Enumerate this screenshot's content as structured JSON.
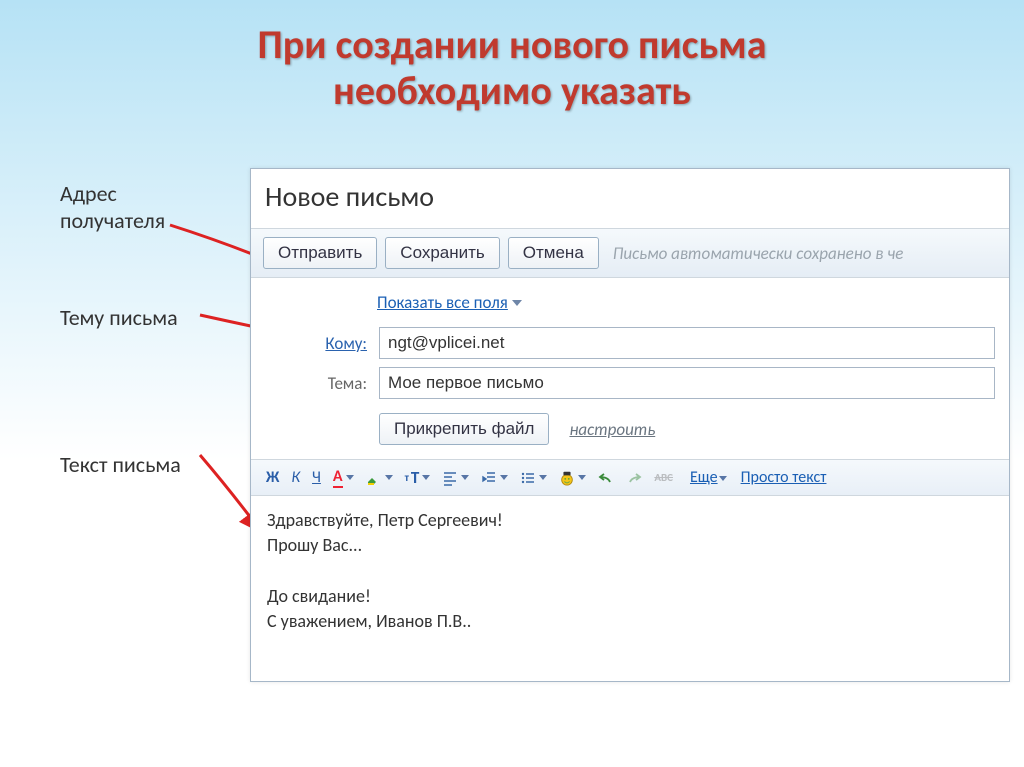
{
  "slide": {
    "title": "При создании нового письма\nнеобходимо указать"
  },
  "labels": {
    "address": "Адрес\nполучателя",
    "subject": "Тему письма",
    "body": "Текст письма"
  },
  "window": {
    "title": "Новое письмо",
    "buttons": {
      "send": "Отправить",
      "save": "Сохранить",
      "cancel": "Отмена"
    },
    "status": "Письмо автоматически сохранено в че",
    "show_all_fields": "Показать все поля",
    "to_label": "Кому:",
    "to_value": "ngt@vplicei.net",
    "subject_label": "Тема:",
    "subject_value": "Мое первое письмо",
    "attach_button": "Прикрепить файл",
    "configure": "настроить",
    "more": "Еще",
    "plain_text": "Просто текст",
    "format": {
      "bold": "Ж",
      "italic": "К",
      "underline": "Ч"
    },
    "body": "Здравствуйте, Петр Сергеевич!\nПрошу Вас...\n\nДо свидание!\nС уважением, Иванов П.В.."
  }
}
